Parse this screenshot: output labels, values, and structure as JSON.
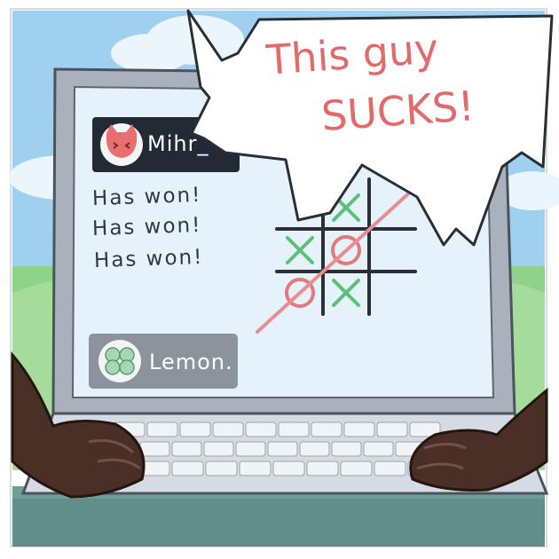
{
  "speech_bubble": {
    "line1": "This guy",
    "line2": "SUCKS!"
  },
  "chat": {
    "top_user": {
      "name": "Mihr_",
      "avatar": "red-cat-avatar"
    },
    "messages": [
      "Has won!",
      "Has won!",
      "Has won!"
    ],
    "bottom_user": {
      "name": "Lemon.",
      "avatar": "green-clover-avatar"
    }
  },
  "tic_tac_toe": {
    "board": [
      [
        "",
        "X",
        ""
      ],
      [
        "X",
        "O",
        ""
      ],
      [
        "O",
        "X",
        ""
      ]
    ],
    "x_color": "#5cc177",
    "o_color": "#e3797b",
    "win_line_color": "#e88e8f"
  },
  "colors": {
    "sky": "#9fd0ef",
    "screen": "#e6f2fb",
    "laptop": "#a9b1bc",
    "chat_bar": "#222a35",
    "bubble_text": "#e36a6a",
    "hands": "#4a2f27"
  }
}
